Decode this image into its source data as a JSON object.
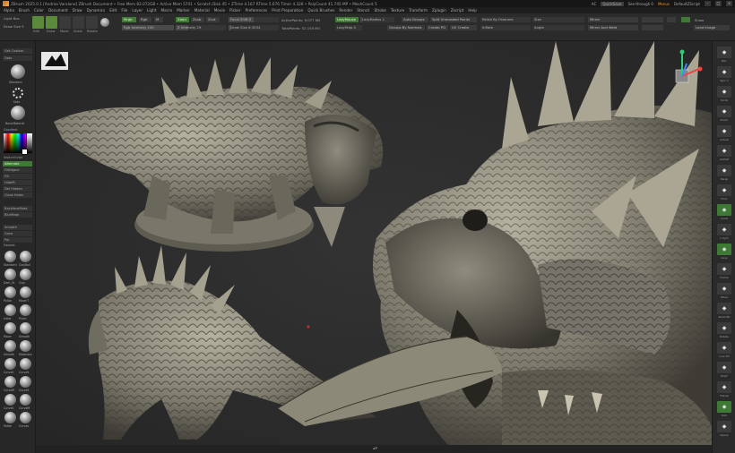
{
  "titlebar": {
    "text": "ZBrush 2025.0.1 [Andrea Varalone]   ZBrush Document   • Free Mem 82.072GB • Active Mem 5741 • Scratch Disk 45 • ZTime 4.167 RTime 5.676 Timer 4.326 • PolyCount 41.745 MP • MeshCount 5",
    "ac_label": "AC",
    "quicksave_label": "QuickSave",
    "see_through_label": "See-through 0",
    "menus_label": "Menus",
    "script_label": "DefaultZScript"
  },
  "menubar": {
    "items": [
      "Alpha",
      "Brush",
      "Color",
      "Document",
      "Draw",
      "Dynamics",
      "Edit",
      "File",
      "Layer",
      "Light",
      "Macro",
      "Marker",
      "Material",
      "Movie",
      "Picker",
      "Preferences",
      "Print Preparation",
      "Quick Brushes",
      "Render",
      "Stencil",
      "Stroke",
      "Texture",
      "Transform",
      "Zplugin",
      "Zscript",
      "Help"
    ]
  },
  "toolbar": {
    "tools": [
      "Edit",
      "Draw",
      "Move",
      "Scale",
      "Rotate"
    ],
    "mrgb": "Mrgb",
    "rgb": "Rgb",
    "m": "M",
    "zadd": "Zadd",
    "zsub": "Zsub",
    "zcut": "Zcut",
    "rgb_intensity": "Rgb Intensity 100",
    "z_intensity": "Z Intensity 25",
    "focal_shift": "Focal Shift 0",
    "draw_size": "Draw Size 6.3034",
    "active_points": "ActivePoints: 9.077 Mil",
    "total_points": "TotalPoints: 52.155 Mil",
    "lazymouse": "LazyMouse",
    "lazyradius": "LazyRadius 1",
    "lazystep": "LazyStep 0",
    "auto_groups": "Auto Groups",
    "split_unmasked": "Split Unmasked Points",
    "groups_by_normals": "Groups By Normals",
    "create_pg": "Create PG",
    "uv_create": "UV Create",
    "polish_by_features": "Polish By Features",
    "inflate": "Inflate",
    "size": "Size",
    "angle": "Angle",
    "mirror": "Mirror",
    "mirror_and_weld": "Mirror And Weld",
    "show_label": "Show",
    "load_image": "Load Image"
  },
  "leftpanel": {
    "get_custom": "Get Custom",
    "dots_label": "Dots",
    "standard": "Standard",
    "dots": "Dots",
    "material": "BasicMaterial",
    "gradient": "Gradient",
    "switch_color": "SwitchColor",
    "alternate": "Alternate",
    "fill_object": "FillObject",
    "fill_label": "Fill",
    "hide_pt": "HidePt",
    "del_hidden": "Del Hidden",
    "close_holes": "Close Holes",
    "backface_mask": "BackfaceMask",
    "blur_mask": "BlurMask",
    "smooth": "Smooth",
    "grow": "Grow",
    "pol": "Pol",
    "double": "Double",
    "brushes": [
      "Standard",
      "ClayBuil",
      "Dam_St",
      "Clay",
      "Polish",
      "Move T",
      "Inflat",
      "Pinch",
      "Move",
      "Smooth",
      "Smooth",
      "Masklass",
      "CurveS",
      "CurveS",
      "CurveM",
      "CurveS",
      "CurveS",
      "CurveM",
      "Polish",
      "Curves"
    ]
  },
  "rightshelf": {
    "items": [
      "Bpr",
      "Spix 3",
      "Scroll",
      "Zoom",
      "Actual",
      "AAHalf",
      "Persp",
      "Floor",
      "Local",
      "L.Sym",
      "Gxyz",
      "Frame",
      "Move",
      "Zoom3D",
      "Rotate",
      "Line Fill",
      "PolyF",
      "Transp",
      "Solo",
      "Xpose"
    ]
  },
  "colors": {
    "accent_green": "#3f7a34",
    "canvas": "#2a2a2a",
    "sculpt": "#8f8c7d"
  }
}
